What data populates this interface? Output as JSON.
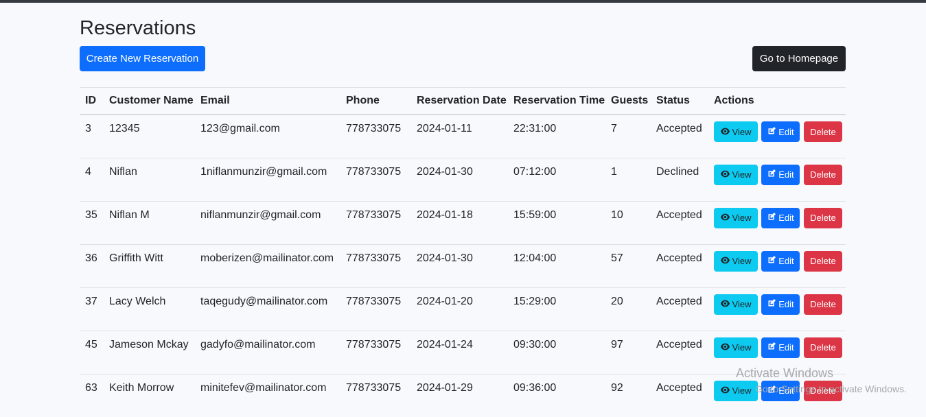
{
  "page": {
    "title": "Reservations"
  },
  "toolbar": {
    "create_label": "Create New Reservation",
    "home_label": "Go to Homepage"
  },
  "table": {
    "headers": [
      "ID",
      "Customer Name",
      "Email",
      "Phone",
      "Reservation Date",
      "Reservation Time",
      "Guests",
      "Status",
      "Actions"
    ],
    "rows": [
      {
        "id": "3",
        "name": "12345",
        "email": "123@gmail.com",
        "phone": "778733075",
        "date": "2024-01-11",
        "time": "22:31:00",
        "guests": "7",
        "status": "Accepted"
      },
      {
        "id": "4",
        "name": "Niflan",
        "email": "1niflanmunzir@gmail.com",
        "phone": "778733075",
        "date": "2024-01-30",
        "time": "07:12:00",
        "guests": "1",
        "status": "Declined"
      },
      {
        "id": "35",
        "name": "Niflan M",
        "email": "niflanmunzir@gmail.com",
        "phone": "778733075",
        "date": "2024-01-18",
        "time": "15:59:00",
        "guests": "10",
        "status": "Accepted"
      },
      {
        "id": "36",
        "name": "Griffith Witt",
        "email": "moberizen@mailinator.com",
        "phone": "778733075",
        "date": "2024-01-30",
        "time": "12:04:00",
        "guests": "57",
        "status": "Accepted"
      },
      {
        "id": "37",
        "name": "Lacy Welch",
        "email": "taqegudy@mailinator.com",
        "phone": "778733075",
        "date": "2024-01-20",
        "time": "15:29:00",
        "guests": "20",
        "status": "Accepted"
      },
      {
        "id": "45",
        "name": "Jameson Mckay",
        "email": "gadyfo@mailinator.com",
        "phone": "778733075",
        "date": "2024-01-24",
        "time": "09:30:00",
        "guests": "97",
        "status": "Accepted"
      },
      {
        "id": "63",
        "name": "Keith Morrow",
        "email": "minitefev@mailinator.com",
        "phone": "778733075",
        "date": "2024-01-29",
        "time": "09:36:00",
        "guests": "92",
        "status": "Accepted"
      }
    ],
    "action_labels": {
      "view": "View",
      "edit": "Edit",
      "delete": "Delete"
    }
  },
  "watermark": {
    "line1": "Activate Windows",
    "line2": "Go to Settings to activate Windows."
  },
  "colors": {
    "primary": "#0d6efd",
    "info": "#0dcaf0",
    "danger": "#dc3545",
    "dark": "#212529"
  },
  "icons": {
    "view": "eye-icon",
    "edit": "edit-icon"
  }
}
